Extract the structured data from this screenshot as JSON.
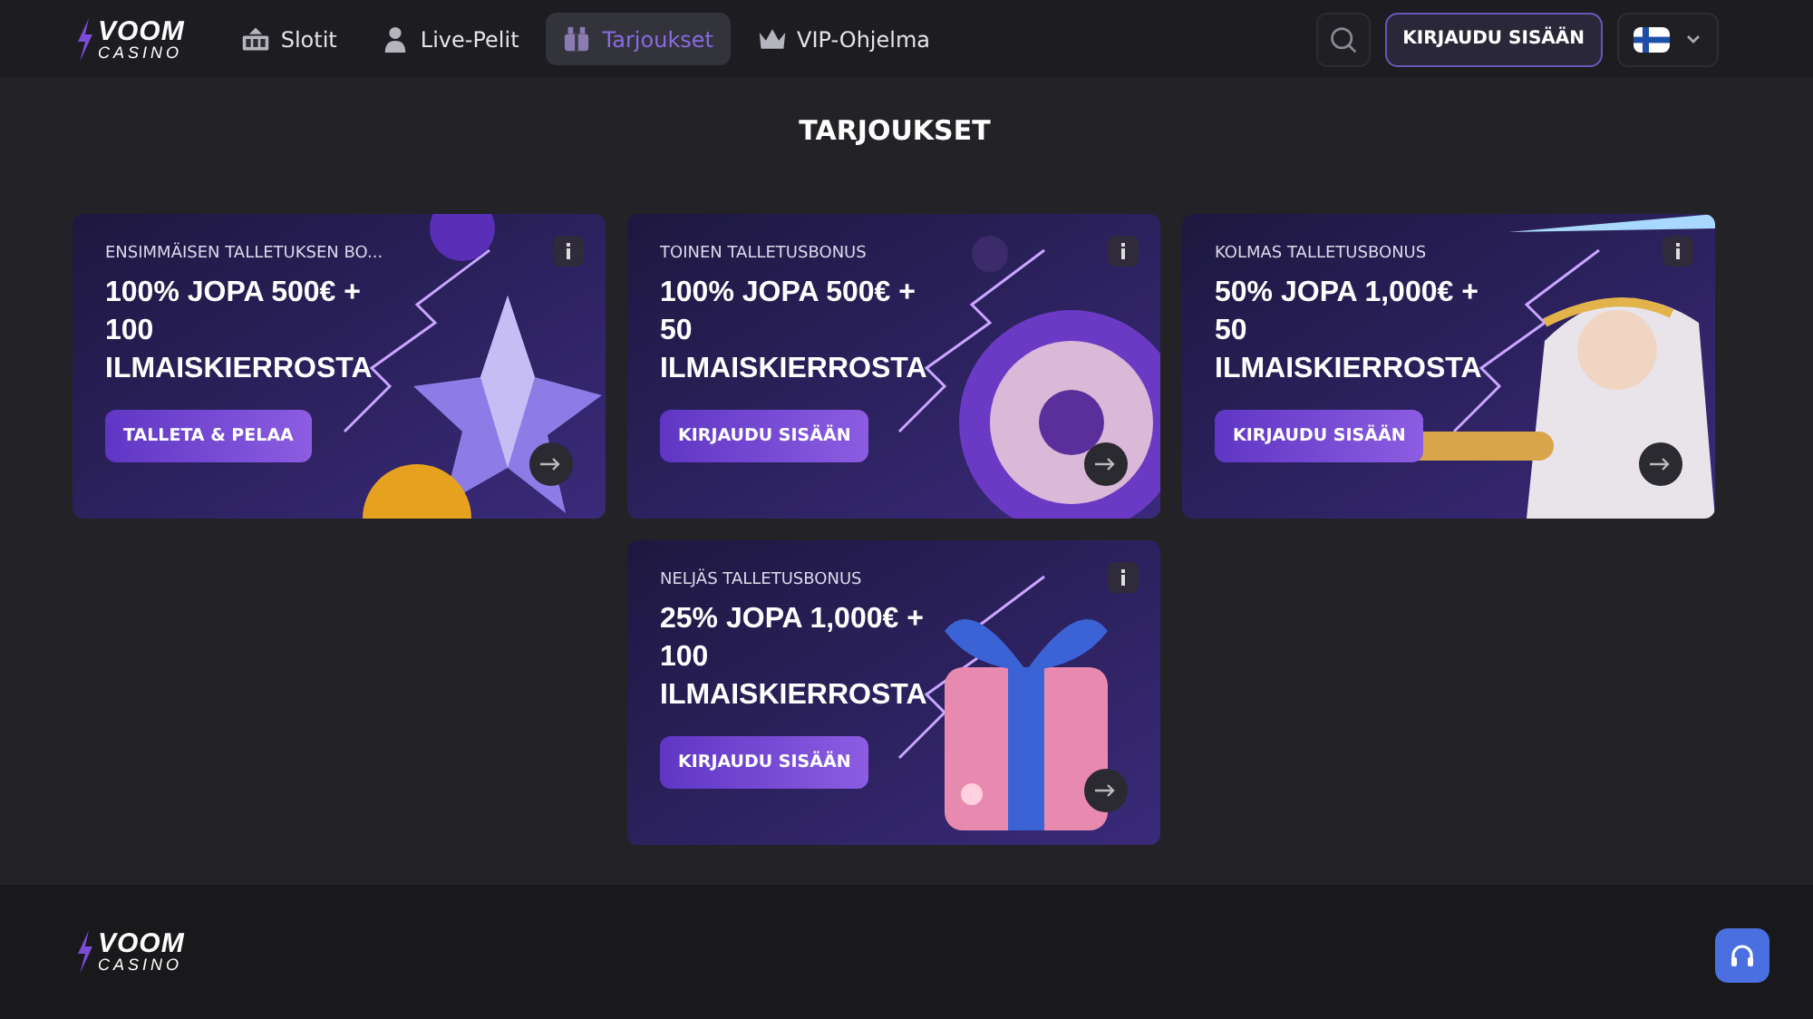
{
  "header": {
    "logo": {
      "top": "VOOM",
      "bottom": "CASINO"
    },
    "nav": [
      {
        "label": "Slotit",
        "selected": false
      },
      {
        "label": "Live-Pelit",
        "selected": false
      },
      {
        "label": "Tarjoukset",
        "selected": true
      },
      {
        "label": "VIP-Ohjelma",
        "selected": false
      }
    ],
    "login_button": "KIRJAUDU SISÄÄN"
  },
  "page_title": "TARJOUKSET",
  "offers": [
    {
      "subtitle": "ENSIMMÄISEN TALLETUKSEN BO...",
      "headline": "100% JOPA 500€ + 100 ILMAISKIERROSTA",
      "button": "TALLETA & PELAA"
    },
    {
      "subtitle": "TOINEN TALLETUSBONUS",
      "headline": "100% JOPA 500€ + 50 ILMAISKIERROSTA",
      "button": "KIRJAUDU SISÄÄN"
    },
    {
      "subtitle": "KOLMAS TALLETUSBONUS",
      "headline": "50% JOPA 1,000€ + 50 ILMAISKIERROSTA",
      "button": "KIRJAUDU SISÄÄN"
    },
    {
      "subtitle": "NELJÄS TALLETUSBONUS",
      "headline": "25% JOPA 1,000€ + 100 ILMAISKIERROSTA",
      "button": "KIRJAUDU SISÄÄN"
    }
  ],
  "footer": {
    "logo": {
      "top": "VOOM",
      "bottom": "CASINO"
    }
  }
}
